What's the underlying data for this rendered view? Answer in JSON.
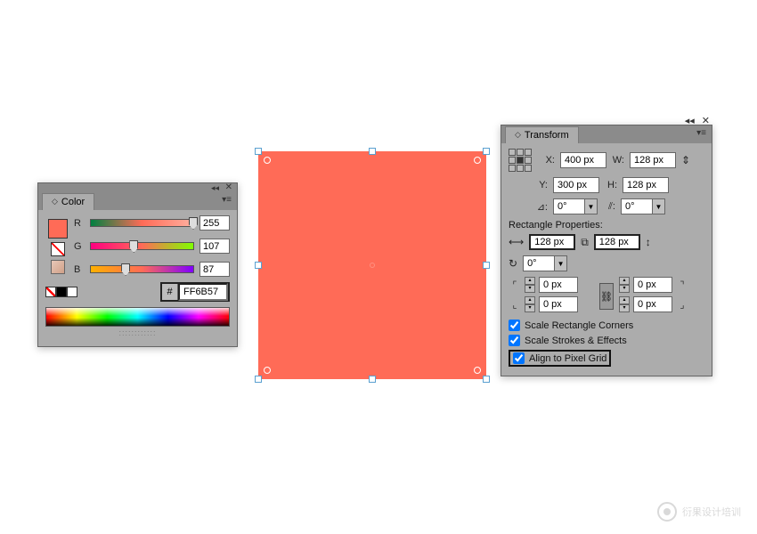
{
  "color_panel": {
    "title": "Color",
    "channels": {
      "r": {
        "label": "R",
        "value": "255",
        "pos_pct": 100
      },
      "g": {
        "label": "G",
        "value": "107",
        "pos_pct": 42
      },
      "b": {
        "label": "B",
        "value": "87",
        "pos_pct": 34
      }
    },
    "hex_prefix": "#",
    "hex": "FF6B57",
    "fill_color": "#ff6b57"
  },
  "transform_panel": {
    "title": "Transform",
    "x_label": "X:",
    "x": "400 px",
    "y_label": "Y:",
    "y": "300 px",
    "w_label": "W:",
    "w": "128 px",
    "h_label": "H:",
    "h": "128 px",
    "rotate_label": "⊿:",
    "rotate": "0°",
    "shear_label": "⫽:",
    "shear": "0°",
    "rect_props_label": "Rectangle Properties:",
    "rw": "128 px",
    "rh": "128 px",
    "corner_angle": "0°",
    "corners": {
      "tl": "0 px",
      "tr": "0 px",
      "bl": "0 px",
      "br": "0 px"
    },
    "scale_corners_label": "Scale Rectangle Corners",
    "scale_corners": true,
    "scale_strokes_label": "Scale Strokes & Effects",
    "scale_strokes": true,
    "align_pixel_label": "Align to Pixel Grid",
    "align_pixel": true
  },
  "watermark": "衍果设计培训"
}
